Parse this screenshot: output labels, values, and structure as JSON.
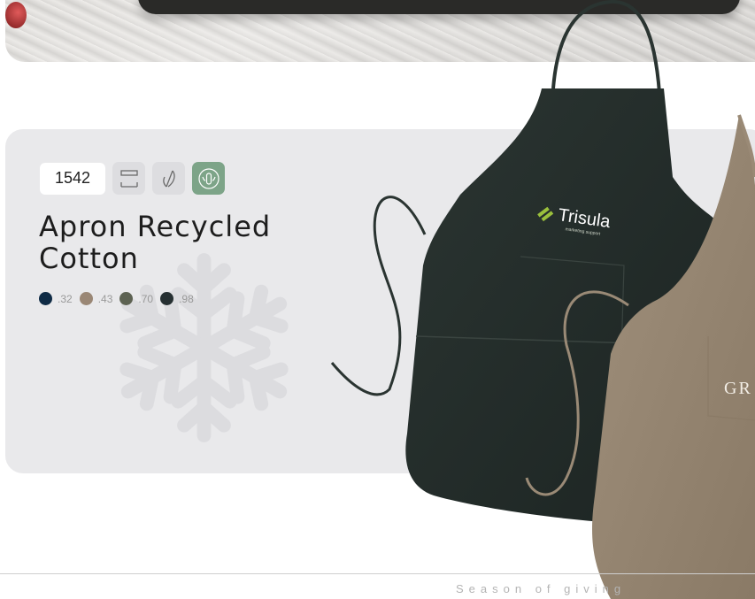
{
  "product": {
    "code": "1542",
    "name_line1": "Apron Recycled",
    "name_line2": "Cotton"
  },
  "badges": [
    {
      "icon": "print-area-icon"
    },
    {
      "icon": "embroidery-needle-icon"
    },
    {
      "icon": "recycled-eco-icon",
      "color": "#7da488"
    }
  ],
  "colors": [
    {
      "hex": "#0f2b45",
      "code": ".32"
    },
    {
      "hex": "#9a8775",
      "code": ".43"
    },
    {
      "hex": "#5d6252",
      "code": ".70"
    },
    {
      "hex": "#263032",
      "code": ".98"
    }
  ],
  "apron_logo": {
    "brand": "Trisula",
    "tagline": "marketing support",
    "second_brand": "GR"
  },
  "footer": {
    "text": "Season of giving"
  }
}
